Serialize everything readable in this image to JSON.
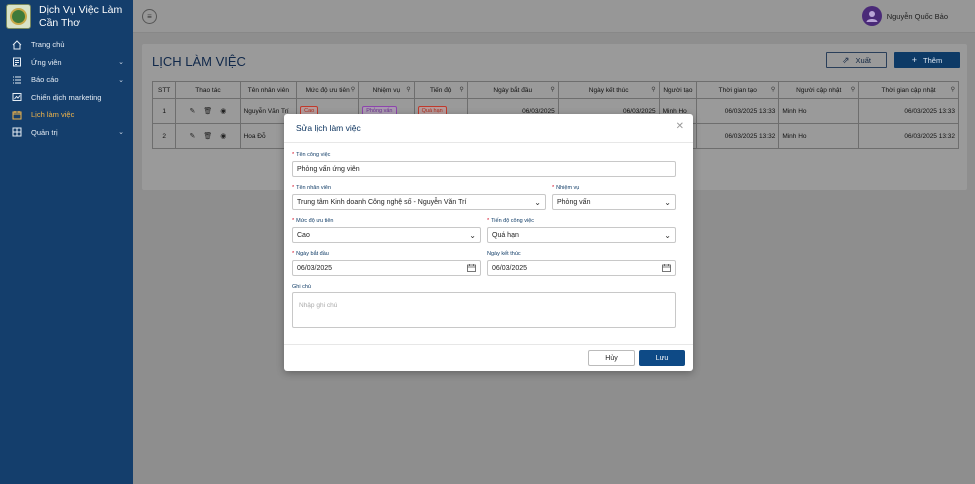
{
  "sidebar": {
    "brand_line1": "Dịch Vụ Việc Làm",
    "brand_line2": "Cần Thơ",
    "items": [
      {
        "label": "Trang chủ",
        "icon": "home-icon"
      },
      {
        "label": "Ứng viên",
        "icon": "candidates-icon"
      },
      {
        "label": "Báo cáo",
        "icon": "report-icon"
      },
      {
        "label": "Chiến dịch marketing",
        "icon": "campaign-icon"
      },
      {
        "label": "Lịch làm việc",
        "icon": "calendar-icon"
      },
      {
        "label": "Quản trị",
        "icon": "admin-icon"
      }
    ]
  },
  "topbar": {
    "username": "Nguyễn Quốc Bảo"
  },
  "page": {
    "title": "LỊCH LÀM VIỆC",
    "export_label": "Xuất",
    "add_label": "Thêm"
  },
  "table": {
    "headers": [
      "STT",
      "Thao tác",
      "Tên nhân viên",
      "Mức độ ưu tiên",
      "Nhiệm vụ",
      "Tiến độ",
      "Ngày bắt đầu",
      "Ngày kết thúc",
      "Người tạo",
      "Thời gian tạo",
      "Người cập nhật",
      "Thời gian cập nhật"
    ],
    "rows": [
      {
        "stt": "1",
        "employee": "Nguyễn Văn Trí",
        "priority": "Cao",
        "task": "Phỏng vấn",
        "progress": "Quá hạn",
        "start": "06/03/2025",
        "end": "06/03/2025",
        "creator": "Minh Ho",
        "created": "06/03/2025 13:33",
        "updater": "Minh Ho",
        "updated": "06/03/2025 13:33"
      },
      {
        "stt": "2",
        "employee": "Hoa Đỗ",
        "priority": "",
        "task": "",
        "progress": "",
        "start": "",
        "end": "",
        "creator": "",
        "created": "06/03/2025 13:32",
        "updater": "Minh Ho",
        "updated": "06/03/2025 13:32"
      }
    ]
  },
  "modal": {
    "title": "Sửa lịch làm việc",
    "job_name_label": "Tên công việc",
    "job_name_value": "Phỏng vấn ứng viên",
    "employee_label": "Tên nhân viên",
    "employee_value": "Trung tâm Kinh doanh Công nghệ số - Nguyễn Văn Trí",
    "task_label": "Nhiệm vụ",
    "task_value": "Phỏng vấn",
    "priority_label": "Mức độ ưu tiên",
    "priority_value": "Cao",
    "progress_label": "Tiến độ công việc",
    "progress_value": "Quá hạn",
    "start_label": "Ngày bắt đầu",
    "start_value": "06/03/2025",
    "end_label": "Ngày kết thúc",
    "end_value": "06/03/2025",
    "notes_label": "Ghi chú",
    "notes_placeholder": "Nhập ghi chú",
    "cancel_label": "Hủy",
    "save_label": "Lưu"
  },
  "colors": {
    "sidebar_bg": "#143e6c",
    "active_nav": "#f2b54a",
    "primary": "#0e4a86",
    "required": "#d0021b"
  }
}
